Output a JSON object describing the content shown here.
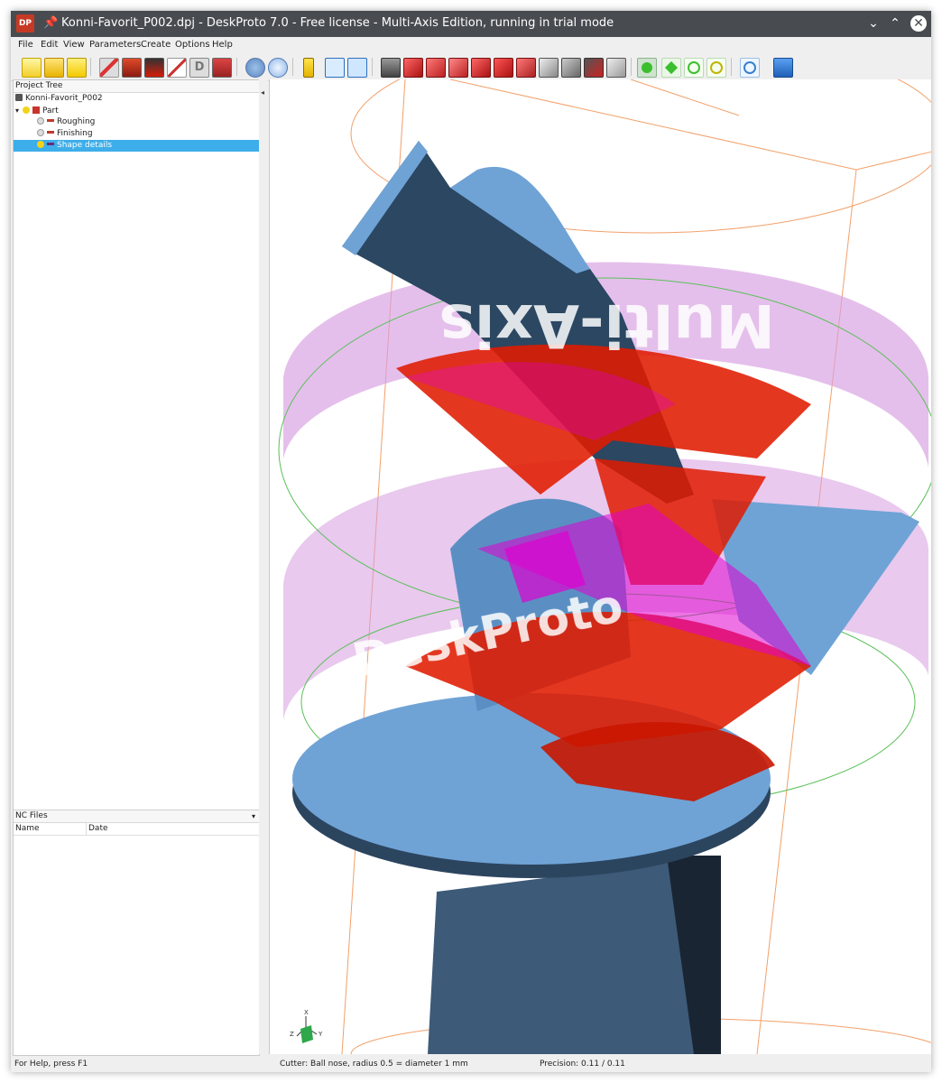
{
  "window": {
    "title": "Konni-Favorit_P002.dpj - DeskProto 7.0 - Free license - Multi-Axis Edition, running in trial mode",
    "logo_text": "DP",
    "pin_icon": "pin-icon",
    "controls": {
      "minimize": "⌄",
      "maximize": "⌃",
      "close": "✕"
    }
  },
  "menu": [
    "File",
    "Edit",
    "View",
    "Parameters",
    "Create",
    "Options",
    "Help"
  ],
  "toolbar": {
    "icons": [
      "new-project-icon",
      "open-project-icon",
      "save-project-icon",
      "part-parameters-icon",
      "vector-icon",
      "bitmap-icon",
      "operation-icon",
      "drawing-icon",
      "save-toolpath-icon",
      "view-toolpath-icon",
      "zoom-part-icon",
      "info-icon",
      "grid-icon",
      "window-icon",
      "view-iso-icon",
      "view-front-icon",
      "view-back-icon",
      "view-left-icon",
      "view-right-icon",
      "view-top-icon",
      "view-bottom-icon",
      "view-gray-1-icon",
      "view-gray-2-icon",
      "view-section-icon",
      "view-hide-icon",
      "rotate-mode-icon",
      "pan-mode-icon",
      "zoom-in-icon",
      "zoom-out-icon",
      "zoom-100-icon",
      "help-book-icon"
    ]
  },
  "project_tree": {
    "header": "Project Tree",
    "items": [
      {
        "label": "Konni-Favorit_P002",
        "level": 0
      },
      {
        "label": "Part",
        "level": 1
      },
      {
        "label": "Roughing",
        "level": 2
      },
      {
        "label": "Finishing",
        "level": 2
      },
      {
        "label": "Shape details",
        "level": 2,
        "selected": true
      }
    ]
  },
  "nc_files": {
    "header": "NC Files",
    "columns": [
      "Name",
      "Date"
    ]
  },
  "viewport": {
    "axes": {
      "x": "X",
      "y": "Y",
      "z": "Z"
    },
    "watermark": "DeskProto Multi-Axis"
  },
  "status": {
    "help": "For Help, press F1",
    "cutter": "Cutter: Ball nose, radius 0.5 = diameter 1 mm",
    "precision": "Precision: 0.11 / 0.11"
  },
  "colors": {
    "titlebar": "#484c51",
    "selection": "#3daee9",
    "part": "#6f9fcc",
    "toolpath_red": "#e01b00",
    "toolpath_magenta": "#e000d0",
    "stock_band": "#d79de0"
  }
}
